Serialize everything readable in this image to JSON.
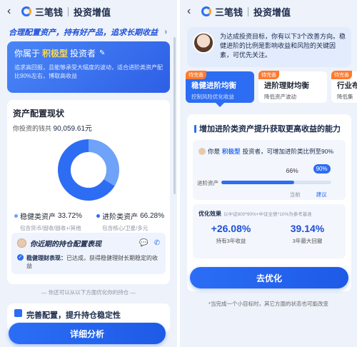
{
  "left": {
    "nav": {
      "back_icon": "chevron-left-icon",
      "brand": "三笔钱",
      "title": "投资增值"
    },
    "slogan": "合理配置资产，持有好产品，追求长期收益",
    "investor": {
      "prefix": "你属于",
      "type": "积极型",
      "suffix": "投资者",
      "desc": "追求高回报，且能够承受大幅度的波动，适合进阶类资产配比90%左右，博取高收益"
    },
    "allocation": {
      "title": "资产配置现状",
      "money_label": "你投资的钱共",
      "money_value": "90,059.61元",
      "donut": [
        {
          "name": "稳健类资产",
          "percent": 33.72,
          "color": "#6fa2f9"
        },
        {
          "name": "进阶类资产",
          "percent": 66.28,
          "color": "#2c6df3"
        }
      ],
      "legend": [
        {
          "label": "稳健类资产",
          "value": "33.72%",
          "sub": "包含货币/固收/固收+/其他",
          "color": "#6fa2f9"
        },
        {
          "label": "进阶类资产",
          "value": "66.28%",
          "sub": "包含核心/卫星/多元",
          "color": "#2c6df3"
        }
      ]
    },
    "performance": {
      "title": "你近期的持仓配置表现",
      "line_label": "稳健理财表现：",
      "line_text": "已达成，获得稳健理财长期稳定的收益"
    },
    "hint": "— 你还可以从以下方面优化你的持仓 —",
    "next_section": "完善配置，提升持仓稳定性",
    "detail_button": "详细分析"
  },
  "right": {
    "nav": {
      "brand": "三笔钱",
      "title": "投资增值"
    },
    "advice": "为达成投资目标，你有以下3个改善方向。稳健进阶的比例是影响收益和风险的关键因素，可优先关注。",
    "tabs": [
      {
        "badge": "待完善",
        "title": "稳健进阶均衡",
        "sub": "控制风险优化收益",
        "active": true
      },
      {
        "badge": "待完善",
        "title": "进阶理财均衡",
        "sub": "降低资产波动",
        "active": false
      },
      {
        "badge": "待完善",
        "title": "行业布",
        "sub": "降低集",
        "active": false
      }
    ],
    "card": {
      "title": "增加进阶类资产提升获取更高收益的能力",
      "line_prefix": "你是",
      "line_type": "积极型",
      "line_suffix": "投资者，可增加进阶类比例至90%",
      "progress_label": "进阶资产",
      "current_value": "66%",
      "current_fraction": 0.66,
      "target_value": "90%",
      "target_fraction": 0.9,
      "current_tick": "当前",
      "target_tick": "建议",
      "opt_title": "优化效果",
      "opt_note": "以中证800*90%+中证全债*10%为参考基准",
      "metrics": [
        {
          "value": "+26.08%",
          "label": "持有3年收益"
        },
        {
          "value": "39.14%",
          "label": "3年最大回撤"
        }
      ]
    },
    "optimize_button": "去优化",
    "foot_note": "*当完成一个小目标时，其它方面的状态也可能改变"
  }
}
